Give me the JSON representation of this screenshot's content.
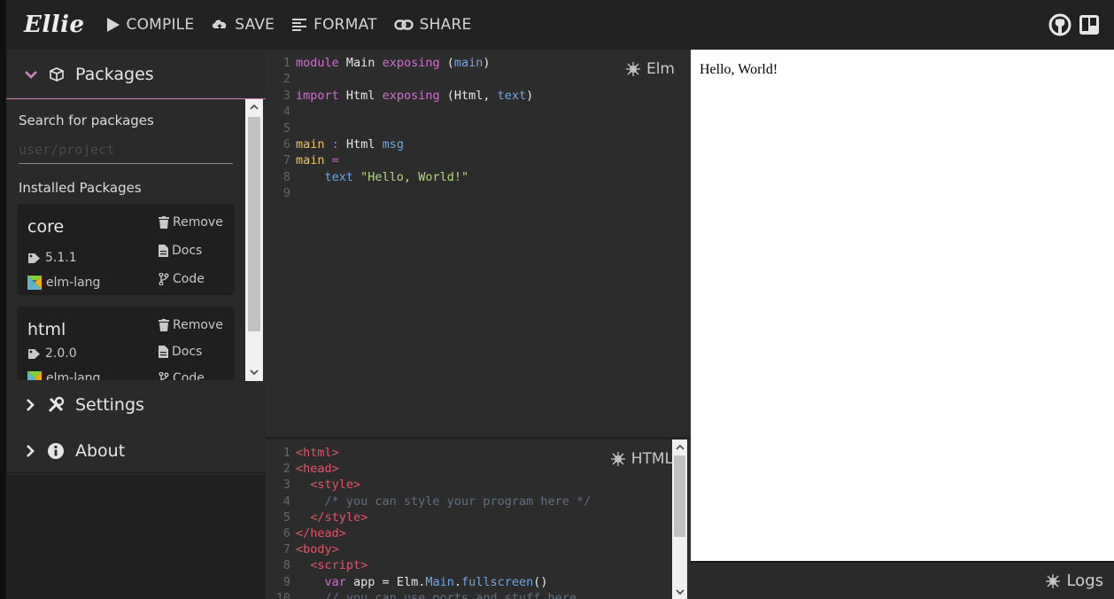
{
  "header": {
    "logo": "Ellie",
    "compile_label": "COMPILE",
    "save_label": "SAVE",
    "format_label": "FORMAT",
    "share_label": "SHARE",
    "github_icon": "github-icon",
    "trello_icon": "trello-icon"
  },
  "sidebar": {
    "packages": {
      "title": "Packages",
      "search_label": "Search for packages",
      "search_placeholder": "user/project",
      "search_value": "",
      "installed_label": "Installed Packages",
      "items": [
        {
          "name": "core",
          "version": "5.1.1",
          "author": "elm-lang",
          "remove": "Remove",
          "docs": "Docs",
          "code": "Code"
        },
        {
          "name": "html",
          "version": "2.0.0",
          "author": "elm-lang",
          "remove": "Remove",
          "docs": "Docs",
          "code": "Code"
        }
      ]
    },
    "settings_title": "Settings",
    "about_title": "About"
  },
  "elm_editor": {
    "label": "Elm",
    "lines": [
      "module Main exposing (main)",
      "",
      "import Html exposing (Html, text)",
      "",
      "",
      "main : Html msg",
      "main =",
      "    text \"Hello, World!\"",
      ""
    ]
  },
  "html_editor": {
    "label": "HTML",
    "lines": [
      "<html>",
      "<head>",
      "  <style>",
      "    /* you can style your program here */",
      "  </style>",
      "</head>",
      "<body>",
      "  <script>",
      "    var app = Elm.Main.fullscreen()",
      "    // you can use ports and stuff here"
    ]
  },
  "output": {
    "text": "Hello, World!"
  },
  "logs": {
    "label": "Logs"
  },
  "colors": {
    "header_bg": "#222222",
    "sidebar_bg": "#2a2a2a",
    "editor_bg": "#2c2c2c",
    "accent_pink": "#d67fbf",
    "keyword": "#d06fd0",
    "identifier": "#6fa8e6",
    "function": "#e9c46a",
    "string": "#b8d97a",
    "tag": "#e0556a",
    "comment": "#5f6f80"
  }
}
